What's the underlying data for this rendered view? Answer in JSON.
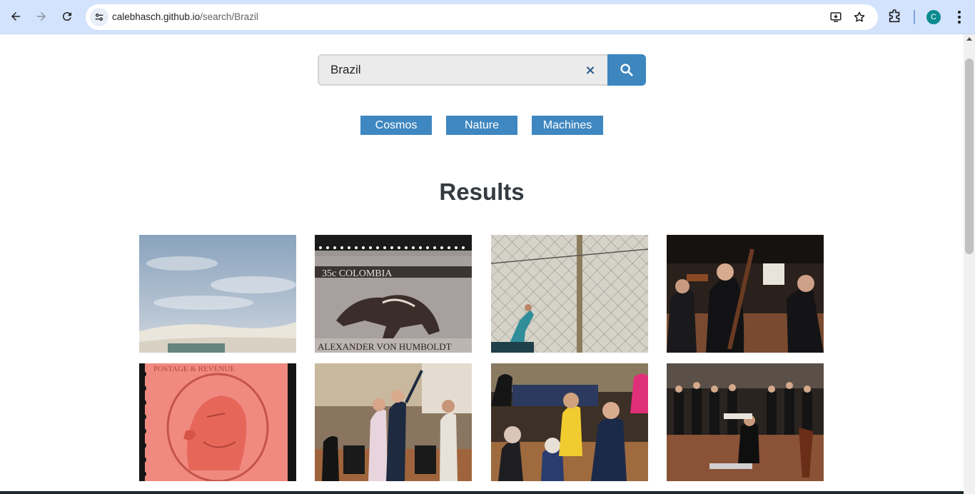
{
  "browser": {
    "url_host": "calebhasch.github.io",
    "url_path": "/search/Brazil",
    "profile_initial": "C"
  },
  "search": {
    "value": "Brazil",
    "clear_glyph": "×"
  },
  "chips": [
    {
      "label": "Cosmos"
    },
    {
      "label": "Nature"
    },
    {
      "label": "Machines"
    }
  ],
  "results": {
    "title": "Results",
    "images": [
      {
        "name": "white-sand-dunes-photo",
        "stamp_text": ""
      },
      {
        "name": "colombia-anteater-stamp",
        "stamp_text": "35c COLOMBIA",
        "stamp_text2": "ALEXANDER VON HUMBOLDT"
      },
      {
        "name": "fence-climbing-photo",
        "stamp_text": ""
      },
      {
        "name": "orchestra-bassoon-photo",
        "stamp_text": ""
      },
      {
        "name": "red-king-stamp",
        "stamp_text": "POSTAGE & REVENUE"
      },
      {
        "name": "orchestra-bow-photo",
        "stamp_text": ""
      },
      {
        "name": "concert-crowd-photo",
        "stamp_text": ""
      },
      {
        "name": "full-orchestra-photo",
        "stamp_text": ""
      }
    ]
  },
  "colors": {
    "chrome_bg": "#d3e3fd",
    "accent_blue": "#3f87c0",
    "title_text": "#333a40"
  }
}
